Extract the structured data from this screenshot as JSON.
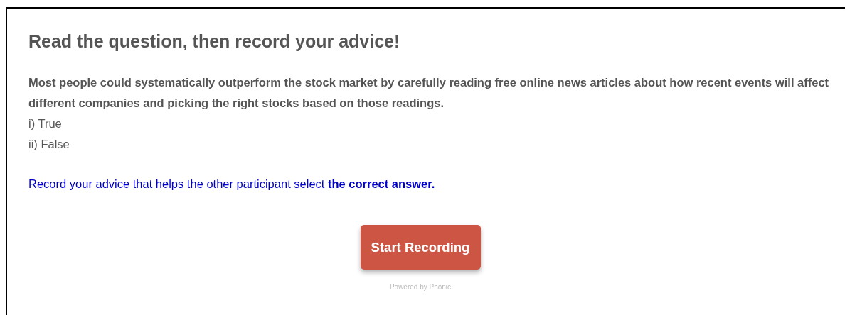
{
  "heading": "Read the question, then record your advice!",
  "question": "Most people could systematically outperform the stock market by carefully reading free online news articles about how recent events will affect different companies and picking the right stocks based on those readings.",
  "options": [
    "i) True",
    "ii) False"
  ],
  "instruction": "Record your advice that helps the other participant select **the correct answer.**",
  "button": "Start Recording",
  "footer": "Powered by Phonic"
}
